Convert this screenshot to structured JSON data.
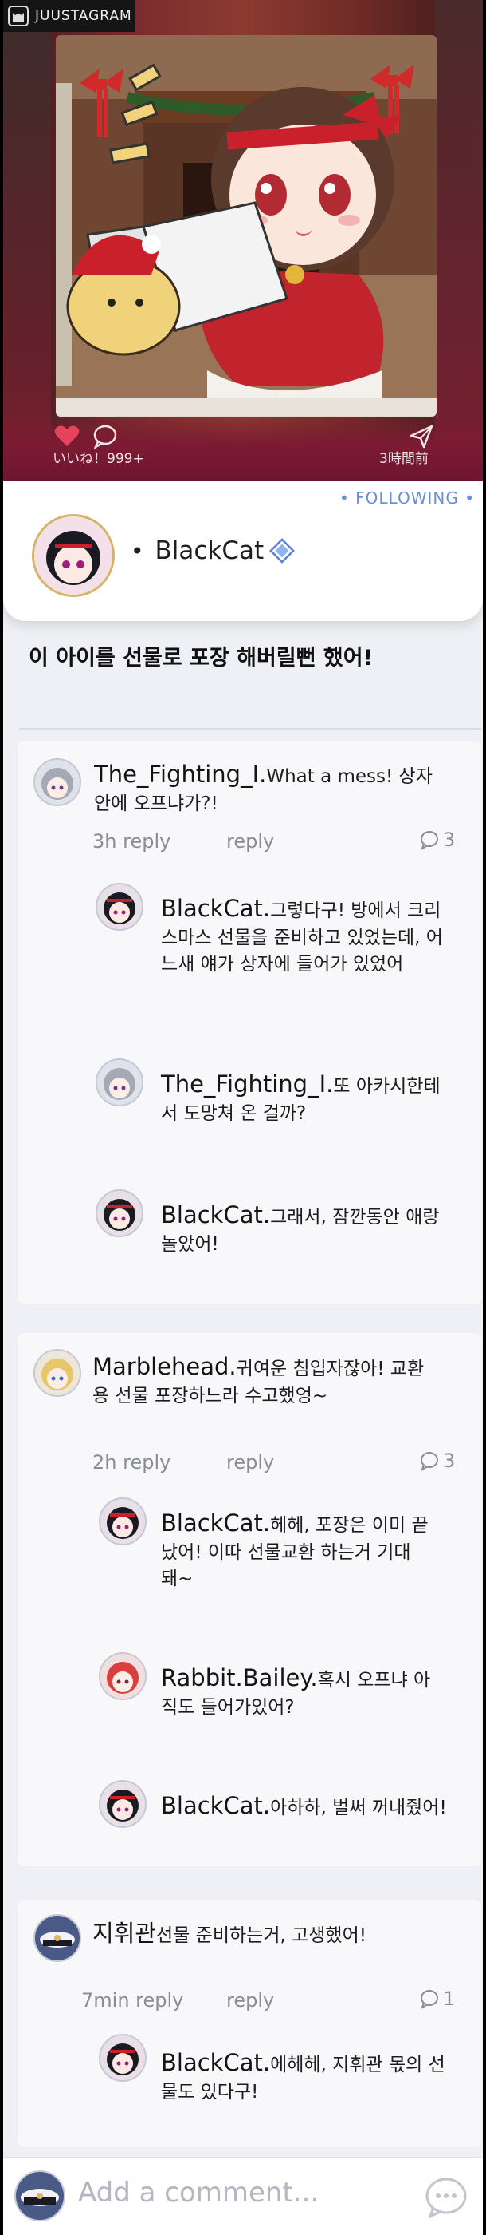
{
  "app": {
    "badge": "JUUSTAGRAM"
  },
  "hero": {
    "likes": "いいね！999+",
    "time": "3時間前"
  },
  "post": {
    "following": "• FOLLOWING •",
    "author": "BlackCat",
    "caption": "이 아이를 선물로 포장 해버릴뻔 했어!"
  },
  "threads": [
    {
      "name": "The_Fighting_I.",
      "text_line1": "What a mess! 상자",
      "text_line2": "안에 오프냐가?!",
      "time": "3h reply",
      "reply": "reply",
      "count": "3",
      "replies": [
        {
          "name": "BlackCat.",
          "line1": "그렇다구! 방에서 크리",
          "line2": "스마스 선물을 준비하고 있었는데, 어",
          "line3": "느새 얘가 상자에 들어가 있었어"
        },
        {
          "name": "The_Fighting_I.",
          "line1": "또 아카시한테",
          "line2": "서 도망쳐 온 걸까?",
          "line3": ""
        },
        {
          "name": "BlackCat.",
          "line1": "그래서, 잠깐동안 애랑",
          "line2": "놀았어!",
          "line3": ""
        }
      ]
    },
    {
      "name": "Marblehead.",
      "text_line1": "귀여운 침입자잖아! 교환",
      "text_line2": "용 선물 포장하느라 수고했엉~",
      "time": "2h reply",
      "reply": "reply",
      "count": "3",
      "replies": [
        {
          "name": "BlackCat.",
          "line1": "헤헤, 포장은 이미 끝",
          "line2": "났어! 이따 선물교환 하는거 기대",
          "line3": "돼~"
        },
        {
          "name": "Rabbit.Bailey.",
          "line1": "혹시 오프냐 아",
          "line2": "직도 들어가있어?",
          "line3": ""
        },
        {
          "name": "BlackCat.",
          "line1": "아하하, 벌써 꺼내줬어!",
          "line2": "",
          "line3": ""
        }
      ]
    },
    {
      "name": "지휘관",
      "text_line1": "선물 준비하는거, 고생했어!",
      "text_line2": "",
      "time": "7min reply",
      "reply": "reply",
      "count": "1",
      "replies": [
        {
          "name": "BlackCat.",
          "line1": "에헤헤, 지휘관 몫의 선",
          "line2": "물도 있다구!",
          "line3": ""
        }
      ]
    }
  ],
  "composer": {
    "placeholder": "Add a comment..."
  },
  "colors": {
    "accent": "#6a8fd8",
    "heart": "#e8435a",
    "verified": "#5a7fe0"
  }
}
